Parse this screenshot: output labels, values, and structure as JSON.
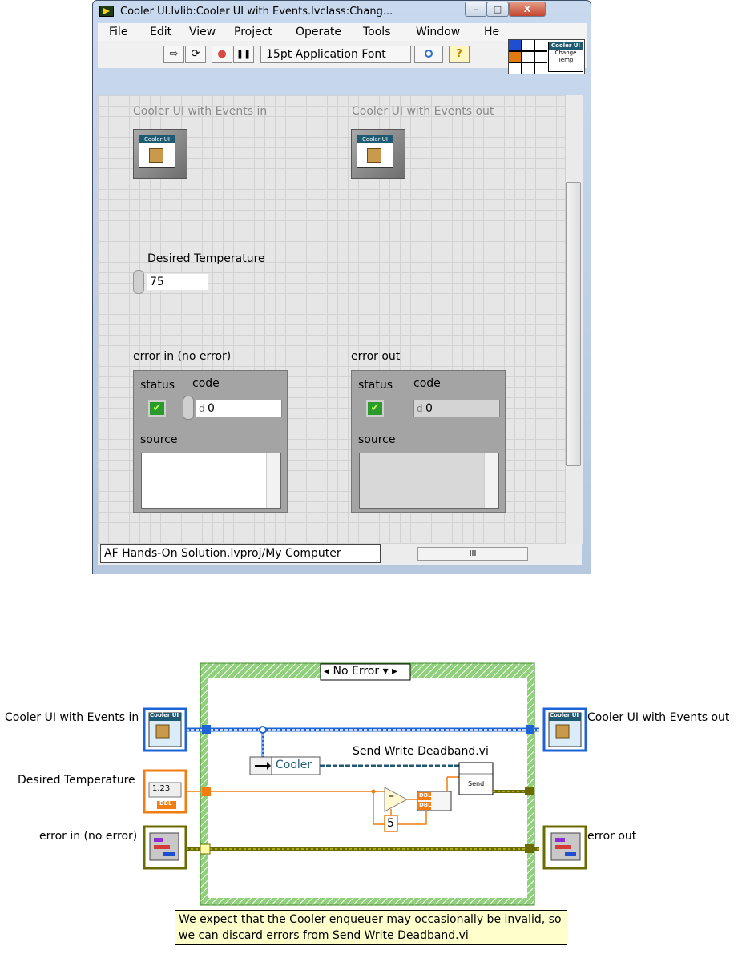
{
  "window": {
    "title": "Cooler UI.lvlib:Cooler UI with Events.lvclass:Chang...",
    "controls": {
      "minimize": "–",
      "maximize": "□",
      "close": "X"
    }
  },
  "menu": [
    "File",
    "Edit",
    "View",
    "Project",
    "Operate",
    "Tools",
    "Window",
    "He"
  ],
  "toolbar": {
    "run_icon": "⇨",
    "run_continuous_icon": "⟳",
    "abort_icon": "●",
    "pause_icon": "❚❚",
    "font": "15pt Application Font",
    "help_icon": "?",
    "vi_icon": {
      "title": "Cooler UI",
      "caption": "Change Temp"
    }
  },
  "front_panel": {
    "class_in_label": "Cooler UI with Events in",
    "class_out_label": "Cooler UI with Events out",
    "class_icon_text": "Cooler UI",
    "desired_temp": {
      "label": "Desired Temperature",
      "value": "75"
    },
    "error_in": {
      "label": "error in (no error)",
      "status_label": "status",
      "code_label": "code",
      "source_label": "source",
      "status_glyph": "✔",
      "code_radix": "d",
      "code": "0"
    },
    "error_out": {
      "label": "error out",
      "status_label": "status",
      "code_label": "code",
      "source_label": "source",
      "status_glyph": "✔",
      "code_radix": "d",
      "code": "0"
    },
    "status_path": "AF Hands-On Solution.lvproj/My Computer",
    "hscroll_thumb": "III"
  },
  "block_diagram": {
    "case_selector": "No Error",
    "case_selector_arrows": {
      "left": "◂",
      "dropdown": "▾",
      "right": "▸"
    },
    "terminals": {
      "class_in": "Cooler UI with Events in",
      "class_out": "Cooler UI with Events out",
      "desired_temp": "Desired Temperature",
      "error_in": "error in (no error)",
      "error_out": "error out"
    },
    "terminal_tags": {
      "class": "Cooler UI",
      "dbl": "DBL",
      "dbl_value": "1.23"
    },
    "unbundle_field": "Cooler",
    "subvi_label": "Send Write Deadband.vi",
    "subvi_text": "Send",
    "subtract_glyph": "–",
    "constant": "5",
    "comment": "We expect that the Cooler enqueuer may occasionally be invalid, so we can discard errors from Send Write  Deadband.vi"
  },
  "colors": {
    "class_wire": "#1f64d6",
    "numeric_wire": "#f07c12",
    "error_wire": "#6b6b00",
    "case_border": "#5cbd3d",
    "comment_bg": "#ffffcc"
  }
}
